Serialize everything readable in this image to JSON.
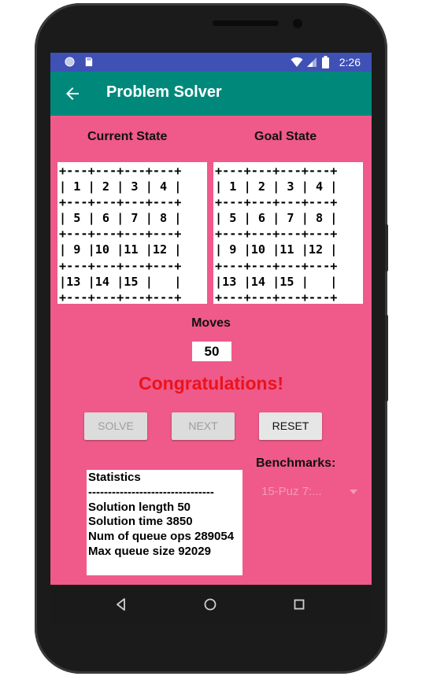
{
  "status_bar": {
    "time": "2:26",
    "left_icons": [
      "circle-notification-icon",
      "sd-card-icon"
    ],
    "right_icons": [
      "wifi-icon",
      "cell-signal-icon",
      "battery-icon"
    ],
    "color": "#3f51b5"
  },
  "app_bar": {
    "title": "Problem Solver",
    "back_icon": "arrow-back-icon",
    "color": "#00897b"
  },
  "puzzle": {
    "current_label": "Current State",
    "goal_label": "Goal State",
    "current_grid": "+---+---+---+---+\n| 1 | 2 | 3 | 4 |\n+---+---+---+---+\n| 5 | 6 | 7 | 8 |\n+---+---+---+---+\n| 9 |10 |11 |12 |\n+---+---+---+---+\n|13 |14 |15 |   |\n+---+---+---+---+",
    "goal_grid": "+---+---+---+---+\n| 1 | 2 | 3 | 4 |\n+---+---+---+---+\n| 5 | 6 | 7 | 8 |\n+---+---+---+---+\n| 9 |10 |11 |12 |\n+---+---+---+---+\n|13 |14 |15 |   |\n+---+---+---+---+"
  },
  "moves": {
    "label": "Moves",
    "value": "50"
  },
  "message": {
    "text": "Congratulations!",
    "color": "#e8141c"
  },
  "buttons": {
    "solve": "SOLVE",
    "next": "NEXT",
    "reset": "RESET"
  },
  "statistics": {
    "title": "Statistics",
    "divider": "--------------------------------",
    "lines": [
      "Solution length   50",
      "Solution time   3850",
      "Num of queue ops   289054",
      "Max queue size   92029"
    ]
  },
  "benchmarks": {
    "label": "Benchmarks:",
    "selected": "15-Puz 7:..."
  },
  "nav_bar": {
    "icons": [
      "back-triangle-icon",
      "home-circle-icon",
      "recents-square-icon"
    ]
  },
  "theme": {
    "screen_background": "#ef5a8a"
  }
}
